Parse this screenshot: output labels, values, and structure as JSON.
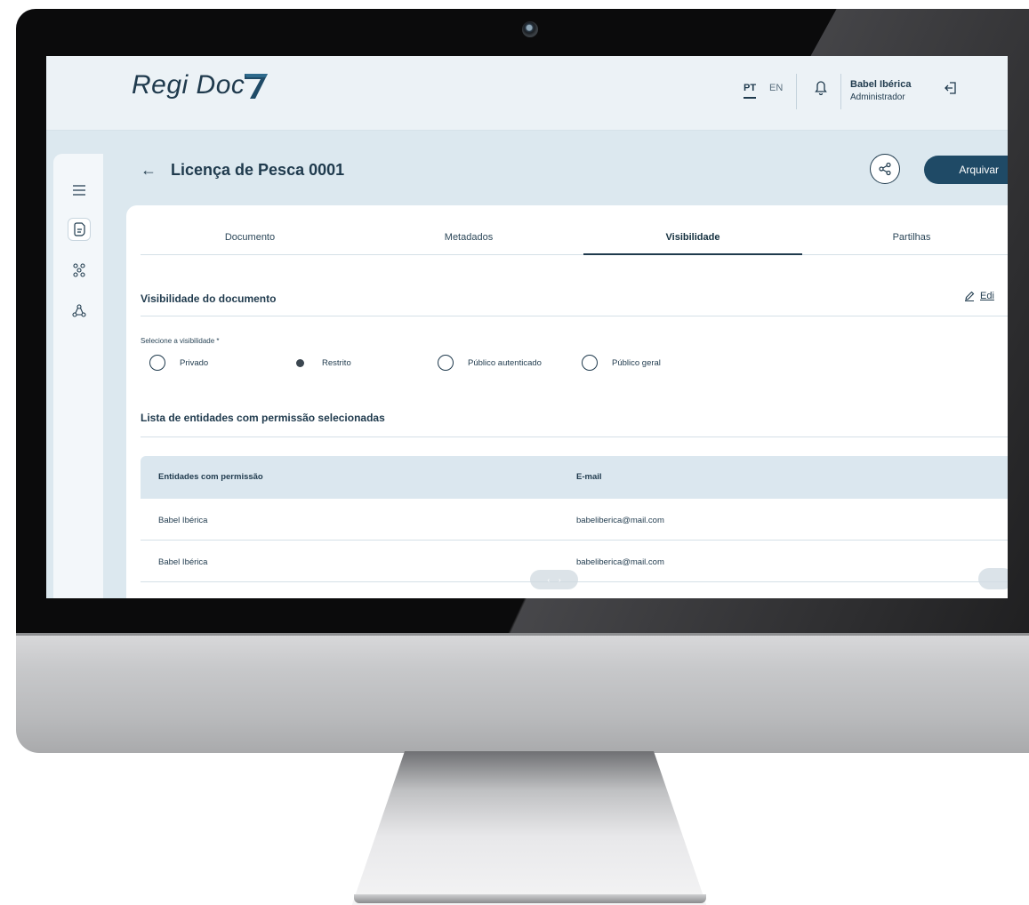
{
  "app": {
    "logo_text": "Regi Doc",
    "languages": {
      "active": "PT",
      "other": "EN"
    },
    "user": {
      "name": "Babel Ibérica",
      "role": "Administrador"
    }
  },
  "page": {
    "title": "Licença de Pesca 0001",
    "archive_label": "Arquivar"
  },
  "tabs": [
    {
      "label": "Documento"
    },
    {
      "label": "Metadados"
    },
    {
      "label": "Visibilidade",
      "active": true
    },
    {
      "label": "Partilhas"
    }
  ],
  "visibility": {
    "section_title": "Visibilidade do documento",
    "edit_label": "Edi",
    "field_label": "Selecione a visibilidade *",
    "options": [
      {
        "label": "Privado",
        "checked": false
      },
      {
        "label": "Restrito",
        "checked": true
      },
      {
        "label": "Público autenticado",
        "checked": false
      },
      {
        "label": "Público geral",
        "checked": false
      }
    ]
  },
  "entities": {
    "section_title": "Lista de entidades com permissão selecionadas",
    "columns": [
      "Entidades com permissão",
      "E-mail"
    ],
    "rows": [
      [
        "Babel Ibérica",
        "babeliberica@mail.com"
      ],
      [
        "Babel Ibérica",
        "babeliberica@mail.com"
      ]
    ]
  },
  "colors": {
    "primary": "#1f3a4d",
    "button": "#1f4a66",
    "table_header": "#dbe7ef",
    "screen_bg": "#dce8ef"
  }
}
